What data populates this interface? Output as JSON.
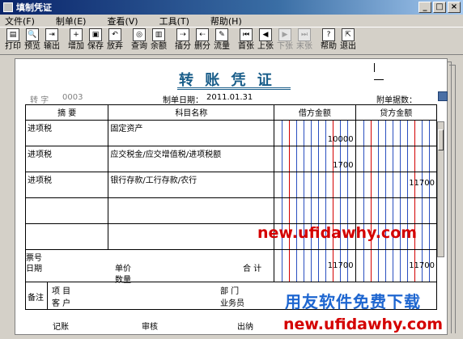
{
  "window": {
    "title": "填制凭证",
    "min": "_",
    "max": "□",
    "close": "×"
  },
  "menu": [
    "文件(F)",
    "制单(E)",
    "查看(V)",
    "工具(T)",
    "帮助(H)"
  ],
  "toolbar": [
    {
      "label": "打印",
      "icon": "printer-icon",
      "glyph": "▤"
    },
    {
      "label": "预览",
      "icon": "preview-icon",
      "glyph": "🔍"
    },
    {
      "label": "输出",
      "icon": "export-icon",
      "glyph": "⇥"
    },
    {
      "label": "增加",
      "icon": "add-icon",
      "glyph": "+"
    },
    {
      "label": "保存",
      "icon": "save-icon",
      "glyph": "▣"
    },
    {
      "label": "放弃",
      "icon": "undo-icon",
      "glyph": "↶"
    },
    {
      "label": "查询",
      "icon": "binoculars-icon",
      "glyph": "◎"
    },
    {
      "label": "余额",
      "icon": "chart-icon",
      "glyph": "▥"
    },
    {
      "label": "插分",
      "icon": "insert-row-icon",
      "glyph": "⇢"
    },
    {
      "label": "删分",
      "icon": "delete-row-icon",
      "glyph": "⇠"
    },
    {
      "label": "流量",
      "icon": "flow-icon",
      "glyph": "✎"
    },
    {
      "label": "首张",
      "icon": "first-icon",
      "glyph": "⏮"
    },
    {
      "label": "上张",
      "icon": "prev-icon",
      "glyph": "◀"
    },
    {
      "label": "下张",
      "icon": "next-icon",
      "glyph": "▶",
      "disabled": true
    },
    {
      "label": "末张",
      "icon": "last-icon",
      "glyph": "⏭",
      "disabled": true
    },
    {
      "label": "帮助",
      "icon": "help-icon",
      "glyph": "?"
    },
    {
      "label": "退出",
      "icon": "exit-icon",
      "glyph": "⇱"
    }
  ],
  "voucher": {
    "title": "转 账 凭 证",
    "type_label": "转  字",
    "number": "0003",
    "date_label": "制单日期：",
    "date": "2011.01.31",
    "attach_label": "附单据数：",
    "headers": {
      "summary": "摘 要",
      "account": "科目名称",
      "debit": "借方金额",
      "credit": "贷方金额"
    },
    "rows": [
      {
        "summary": "进项税",
        "account": "固定资产",
        "debit": "10000",
        "credit": ""
      },
      {
        "summary": "进项税",
        "account": "应交税金/应交增值税/进项税额",
        "debit": "1700",
        "credit": ""
      },
      {
        "summary": "进项税",
        "account": "银行存款/工行存款/农行",
        "debit": "",
        "credit": "11700"
      },
      {
        "summary": "",
        "account": "",
        "debit": "",
        "credit": ""
      },
      {
        "summary": "",
        "account": "",
        "debit": "",
        "credit": ""
      }
    ],
    "ticket_label": "票号",
    "date_row_label": "日期",
    "price_label": "单价",
    "qty_label": "数量",
    "total_label": "合 计",
    "total_debit": "11700",
    "total_credit": "11700",
    "remark_label": "备注",
    "project_label": "项  目",
    "customer_label": "客  户",
    "dept_label": "部  门",
    "staff_label": "业务员",
    "footer": {
      "bookkeep": "记账",
      "audit": "审核",
      "cashier": "出纳"
    }
  },
  "watermark": {
    "mid": "new.ufidawhy.com",
    "bottom_top": "用友软件免费下载",
    "bottom": "new.ufidawhy.com"
  },
  "colors": {
    "title_blue": "#1a5e8a",
    "grid_red": "#d40000",
    "grid_blue": "#2a4fc0",
    "watermark_red": "#d40000",
    "watermark_blue": "#1e66d0"
  }
}
